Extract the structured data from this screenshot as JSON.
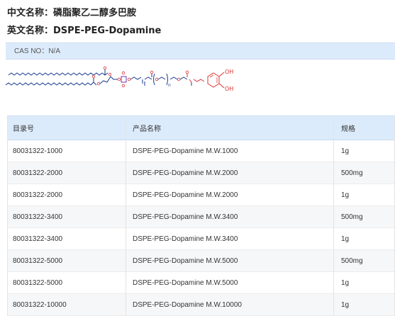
{
  "header": {
    "cn_label": "中文名称：",
    "cn_value": "磷脂聚乙二醇多巴胺",
    "en_label": "英文名称：",
    "en_value": "DSPE-PEG-Dopamine"
  },
  "cas": {
    "text": "CAS NO：N/A"
  },
  "structure": {
    "oh_top": "OH",
    "oh_bottom": "OH",
    "n_sub": "n"
  },
  "table": {
    "columns": [
      "目录号",
      "产品名称",
      "规格"
    ],
    "rows": [
      {
        "cat": "80031322-1000",
        "name": "DSPE-PEG-Dopamine M.W.1000",
        "spec": "1g"
      },
      {
        "cat": "80031322-2000",
        "name": "DSPE-PEG-Dopamine M.W.2000",
        "spec": "500mg"
      },
      {
        "cat": "80031322-2000",
        "name": "DSPE-PEG-Dopamine M.W.2000",
        "spec": "1g"
      },
      {
        "cat": "80031322-3400",
        "name": "DSPE-PEG-Dopamine M.W.3400",
        "spec": "500mg"
      },
      {
        "cat": "80031322-3400",
        "name": "DSPE-PEG-Dopamine M.W.3400",
        "spec": "1g"
      },
      {
        "cat": "80031322-5000",
        "name": "DSPE-PEG-Dopamine M.W.5000",
        "spec": "500mg"
      },
      {
        "cat": "80031322-5000",
        "name": "DSPE-PEG-Dopamine M.W.5000",
        "spec": "1g"
      },
      {
        "cat": "80031322-10000",
        "name": "DSPE-PEG-Dopamine M.W.10000",
        "spec": "1g"
      }
    ]
  }
}
